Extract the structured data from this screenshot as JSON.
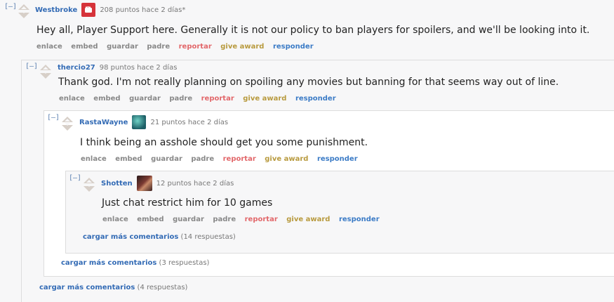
{
  "comments": [
    {
      "collapse": "[–]",
      "author": "Westbroke",
      "meta": "208 puntos hace 2 días*",
      "body": "Hey all, Player Support here. Generally it is not our policy to ban players for spoilers, and we'll be looking into it.",
      "flair_color": "#d6333a",
      "flair_icon": "fist-icon"
    },
    {
      "collapse": "[–]",
      "author": "thercio27",
      "meta": "98 puntos hace 2 días",
      "body": "Thank god. I'm not really planning on spoiling any movies but banning for that seems way out of line."
    },
    {
      "collapse": "[–]",
      "author": "RastaWayne",
      "meta": "21 puntos hace 2 días",
      "body": "I think being an asshole should get you some punishment.",
      "flair_color": "#1d8f8a",
      "flair_icon": "champion-avatar-icon"
    },
    {
      "collapse": "[–]",
      "author": "Shotten",
      "meta": "12 puntos hace 2 días",
      "body": "Just chat restrict him for 10 games",
      "flair_color": "#5a2a2a",
      "flair_icon": "champion-avatar-icon"
    }
  ],
  "buttons": {
    "link": "enlace",
    "embed": "embed",
    "save": "guardar",
    "parent": "padre",
    "report": "reportar",
    "award": "give award",
    "reply": "responder"
  },
  "more": [
    {
      "label": "cargar más comentarios",
      "count": "(14 respuestas)"
    },
    {
      "label": "cargar más comentarios",
      "count": "(3 respuestas)"
    },
    {
      "label": "cargar más comentarios",
      "count": "(4 respuestas)"
    }
  ]
}
